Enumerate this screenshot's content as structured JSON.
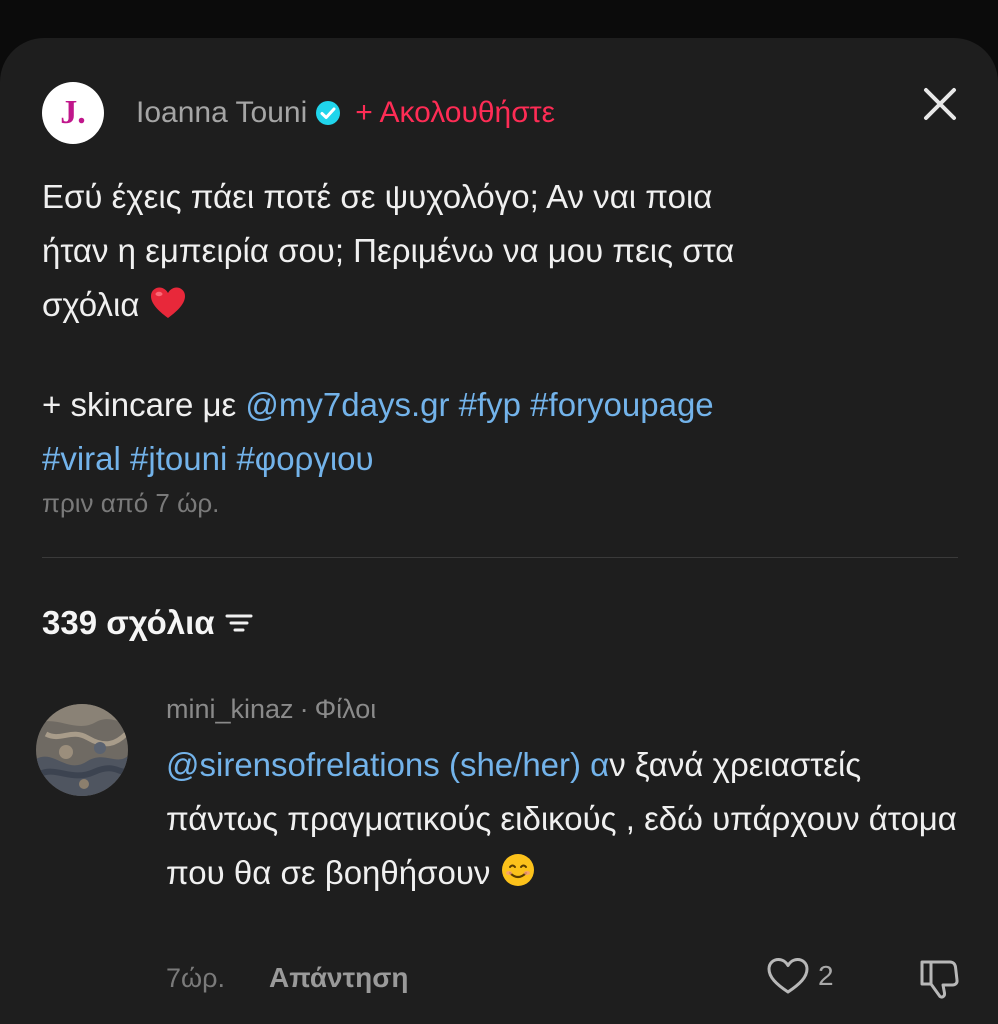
{
  "post": {
    "logo_letter": "J.",
    "author": "Ioanna Touni",
    "follow_label": "+ Ακολουθήστε",
    "caption_line1": "Εσύ έχεις πάει ποτέ σε ψυχολόγο; Αν ναι ποια",
    "caption_line2": "ήταν η εμπειρία σου; Περιμένω να μου πεις στα",
    "caption_line3": "σχόλια",
    "caption_prefix": "+ skincare με",
    "mention": "@my7days.gr",
    "hashtags_line1": [
      "#fyp",
      "#foryoupage"
    ],
    "hashtags_line2": [
      "#viral",
      "#jtouni",
      "#φοργιου"
    ],
    "posted": "πριν από 7 ώρ."
  },
  "comments_header": {
    "count_label": "339 σχόλια"
  },
  "comment": {
    "username": "mini_kinaz",
    "separator": "·",
    "relation": "Φίλοι",
    "mention": "@sirensofrelations (she/her)",
    "mention_tail": " α",
    "text_rest": "ν ξανά χρειαστείς πάντως πραγματικούς ειδικούς , εδώ υπάρχουν άτομα που θα σε βοηθήσουν",
    "time": "7ώρ.",
    "reply_label": "Απάντηση",
    "likes": "2"
  },
  "colors": {
    "background": "#1e1e1e",
    "accent_follow": "#fe2c55",
    "link": "#73b3ea",
    "verified": "#20d5ec"
  },
  "icons": {
    "close": "close-icon",
    "verified": "verified-badge-icon",
    "sort": "sort-icon",
    "heart": "heart-outline-icon",
    "dislike": "dislike-icon",
    "red_heart_emoji": "red-heart-emoji",
    "smile_emoji": "smiling-face-emoji"
  }
}
